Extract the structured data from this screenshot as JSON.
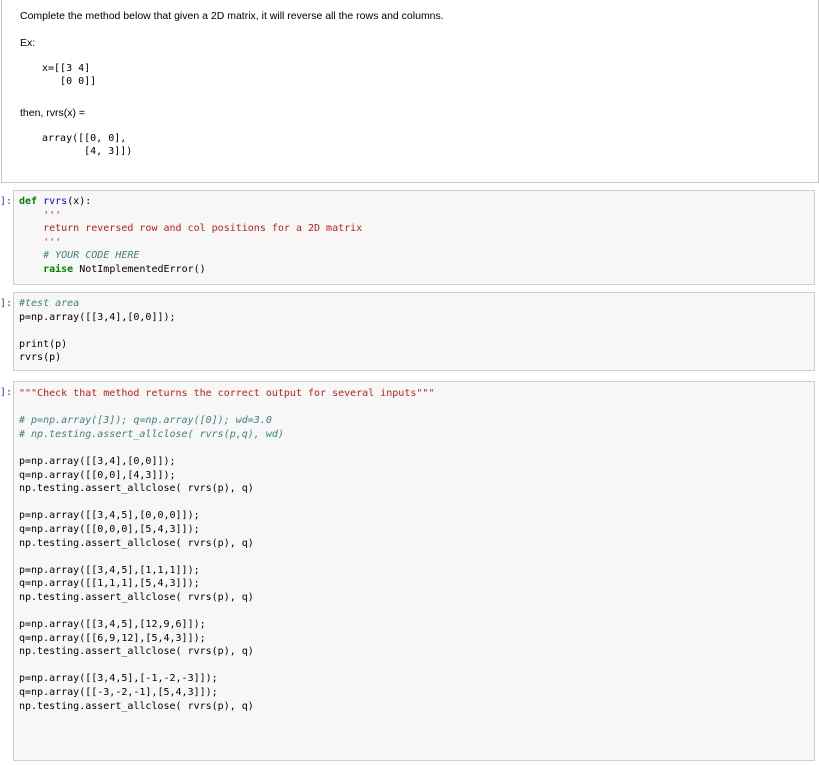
{
  "markdown": {
    "instruction": "Complete the method below that given a 2D matrix, it will reverse all the rows and columns.",
    "ex_label": "Ex:",
    "example_input": "x=[[3 4]\n   [0 0]]",
    "then_label": "then, rvrs(x) =",
    "example_output": "array([[0, 0],\n       [4, 3]])"
  },
  "cells": [
    {
      "prompt": "]:",
      "lines": {
        "def_kw": "def",
        "fn_name": "rvrs",
        "sig_rest": "(x):",
        "doc_open": "    '''",
        "doc_text": "    return reversed row and col positions for a 2D matrix",
        "doc_close": "    '''",
        "comment": "    # YOUR CODE HERE",
        "raise_kw": "    raise",
        "raise_err": "NotImplementedError",
        "raise_end": "()"
      }
    },
    {
      "prompt": "]:",
      "lines": [
        "#test area",
        "p=np.array([[3,4],[0,0]]);",
        "",
        "print(p)",
        "rvrs(p)"
      ]
    },
    {
      "prompt": "]:",
      "docstring": "\"\"\"Check that method returns the correct output for several inputs\"\"\"",
      "comments": [
        "# p=np.array([3]); q=np.array([0]); wd=3.0",
        "# np.testing.assert_allclose( rvrs(p,q), wd)"
      ],
      "tests": [
        [
          "p=np.array([[3,4],[0,0]]);",
          "q=np.array([[0,0],[4,3]]);",
          "np.testing.assert_allclose( rvrs(p), q)"
        ],
        [
          "p=np.array([[3,4,5],[0,0,0]]);",
          "q=np.array([[0,0,0],[5,4,3]]);",
          "np.testing.assert_allclose( rvrs(p), q)"
        ],
        [
          "p=np.array([[3,4,5],[1,1,1]]);",
          "q=np.array([[1,1,1],[5,4,3]]);",
          "np.testing.assert_allclose( rvrs(p), q)"
        ],
        [
          "p=np.array([[3,4,5],[12,9,6]]);",
          "q=np.array([[6,9,12],[5,4,3]]);",
          "np.testing.assert_allclose( rvrs(p), q)"
        ],
        [
          "p=np.array([[3,4,5],[-1,-2,-3]]);",
          "q=np.array([[-3,-2,-1],[5,4,3]]);",
          "np.testing.assert_allclose( rvrs(p), q)"
        ]
      ]
    }
  ]
}
